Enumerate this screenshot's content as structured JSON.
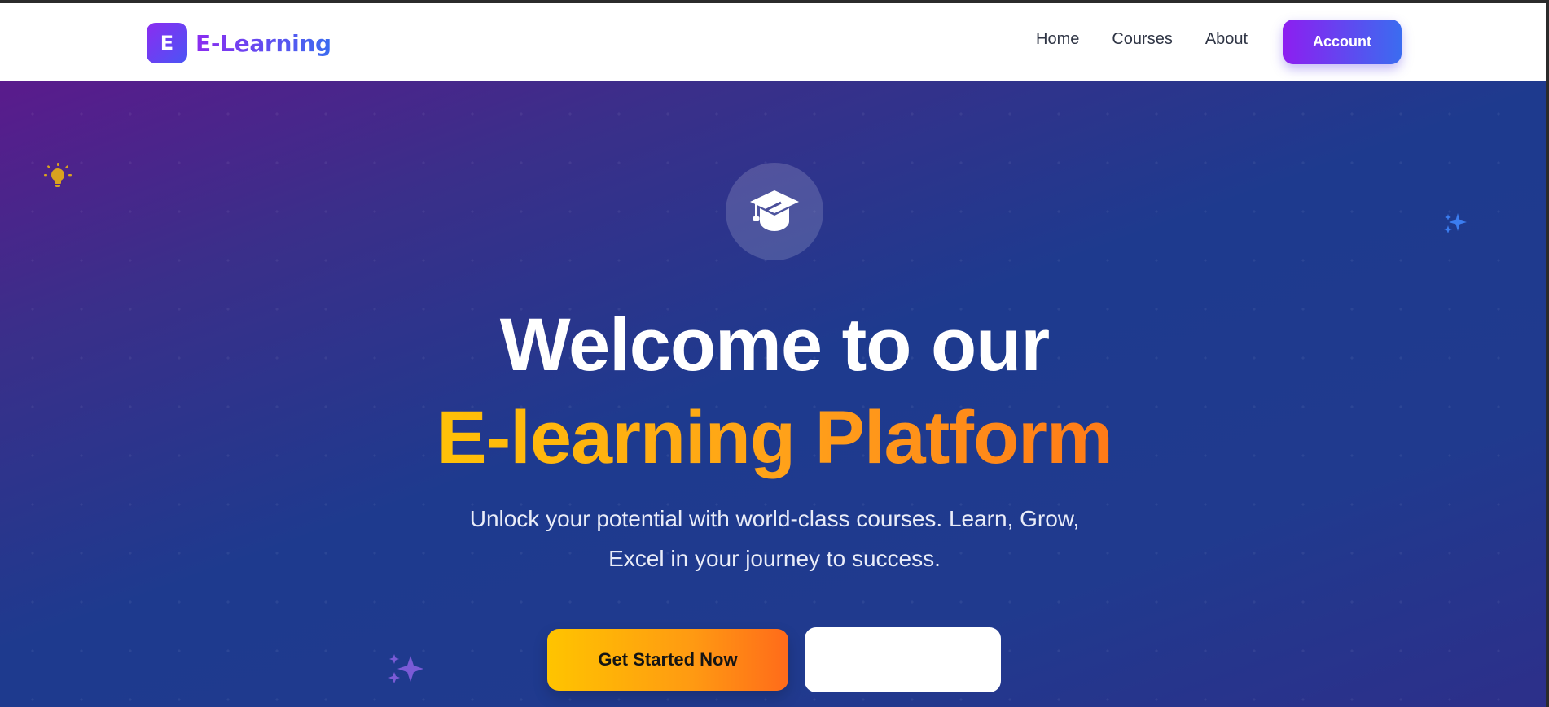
{
  "navbar": {
    "brand_letter": "E",
    "brand_name": "E-Learning",
    "links": [
      "Home",
      "Courses",
      "About"
    ],
    "account_label": "Account"
  },
  "hero": {
    "icon": "graduation-cap-icon",
    "title_line1": "Welcome to our",
    "title_line2": "E-learning Platform",
    "subtitle": "Unlock your potential with world-class courses. Learn, Grow, Excel in your journey to success.",
    "cta_primary": "Get Started Now",
    "cta_secondary": ""
  },
  "decorations": [
    "lightbulb-icon",
    "sparkle-icon",
    "sparkle-icon"
  ],
  "colors": {
    "brand_gradient_start": "#8b2cf0",
    "brand_gradient_end": "#3b6cf0",
    "accent_yellow": "#ffc107",
    "accent_orange": "#ff7a18",
    "hero_purple": "#5a1b8c",
    "hero_blue": "#1e3a8e"
  }
}
